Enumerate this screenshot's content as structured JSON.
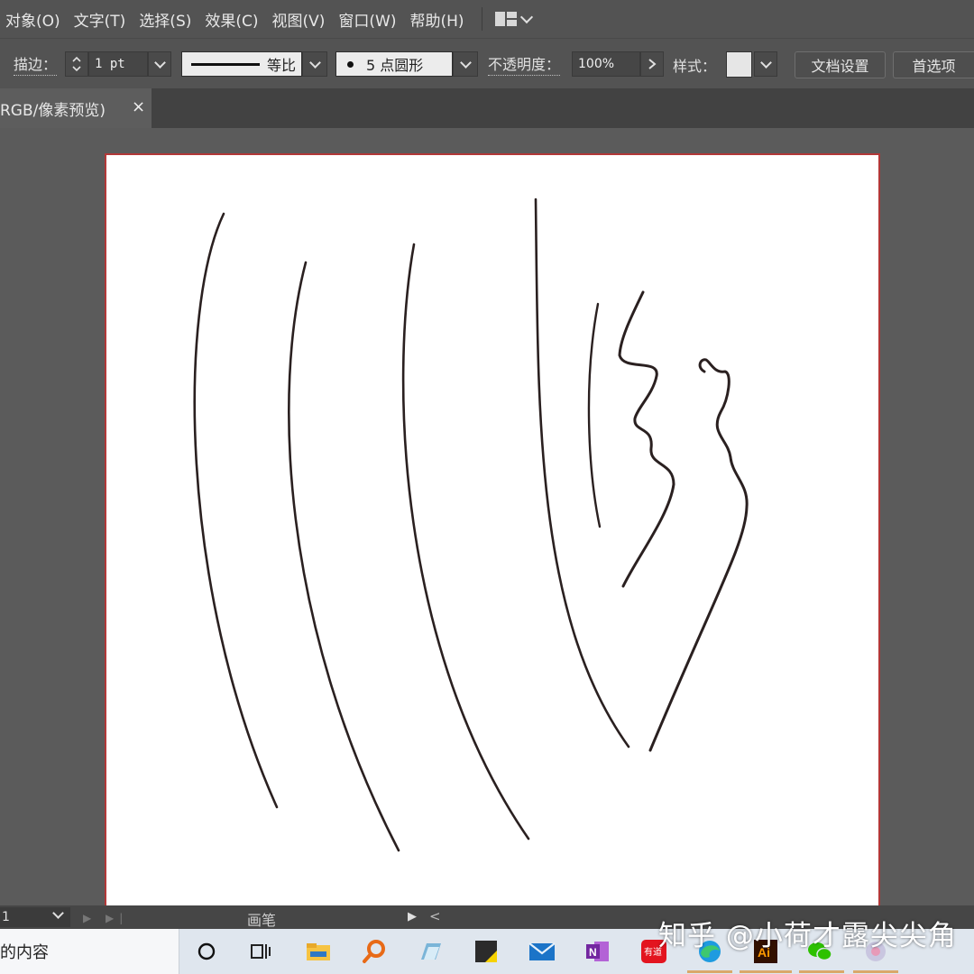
{
  "menubar": {
    "items": [
      "对象(O)",
      "文字(T)",
      "选择(S)",
      "效果(C)",
      "视图(V)",
      "窗口(W)",
      "帮助(H)"
    ]
  },
  "controlbar": {
    "stroke_label": "描边：",
    "stroke_weight": "1 pt",
    "stroke_profile": "等比",
    "brush": "5 点圆形",
    "opacity_label": "不透明度：",
    "opacity_value": "100%",
    "style_label": "样式：",
    "doc_setup": "文档设置",
    "preferences": "首选项"
  },
  "document": {
    "tab_title": "RGB/像素预览)",
    "close": "×"
  },
  "statusbar": {
    "zoom": "1",
    "tool": "画笔"
  },
  "taskbar": {
    "search_text": "的内容",
    "icons": [
      "cortana-icon",
      "task-view-icon",
      "file-explorer-icon",
      "search-app-icon",
      "notepad-icon",
      "sticky-notes-icon",
      "mail-icon",
      "onenote-icon",
      "youdao-icon",
      "edge-icon",
      "illustrator-icon",
      "wechat-icon",
      "app-icon"
    ],
    "youdao_label": "有道",
    "ai_label": "Ai",
    "onenote_label": "N"
  },
  "watermark": "知乎 @小荷才露尖尖角",
  "colors": {
    "ui_dark": "#535353",
    "artboard_border": "#b23838",
    "stroke": "#2a2020"
  }
}
